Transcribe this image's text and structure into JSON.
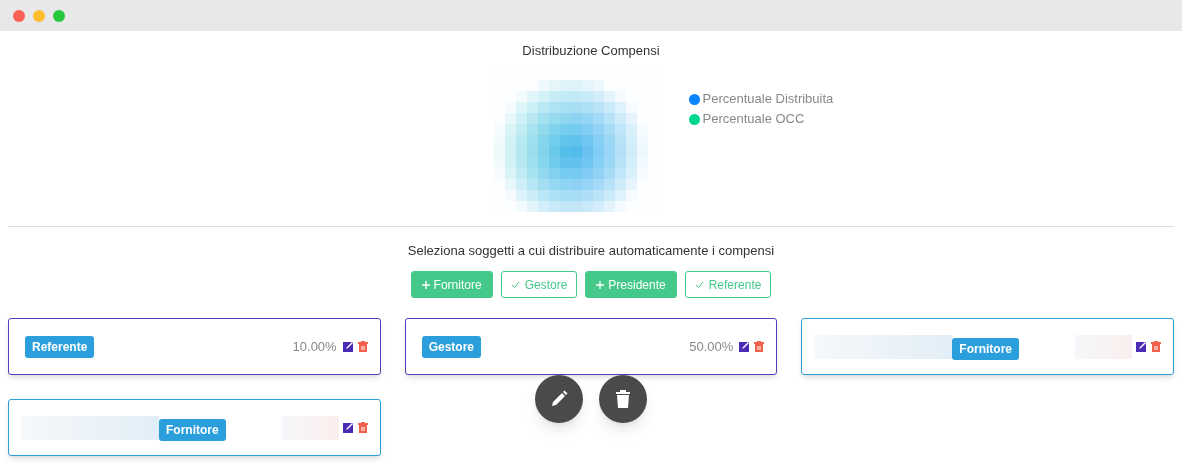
{
  "title": "Distribuzione Compensi",
  "legend": [
    {
      "label": "Percentuale Distribuita",
      "color": "#0a84ff"
    },
    {
      "label": "Percentuale OCC",
      "color": "#00d68f"
    }
  ],
  "prompt": "Seleziona soggetti a cui distribuire automaticamente i compensi",
  "roles": [
    {
      "label": "Fornitore",
      "selected": false
    },
    {
      "label": "Gestore",
      "selected": true
    },
    {
      "label": "Presidente",
      "selected": false
    },
    {
      "label": "Referente",
      "selected": true
    }
  ],
  "cards": [
    {
      "kind": "role",
      "badge": "Referente",
      "value": "10.00%"
    },
    {
      "kind": "role",
      "badge": "Gestore",
      "value": "50.00%"
    },
    {
      "kind": "supplier",
      "badge": "Fornitore"
    },
    {
      "kind": "supplier",
      "badge": "Fornitore"
    }
  ]
}
